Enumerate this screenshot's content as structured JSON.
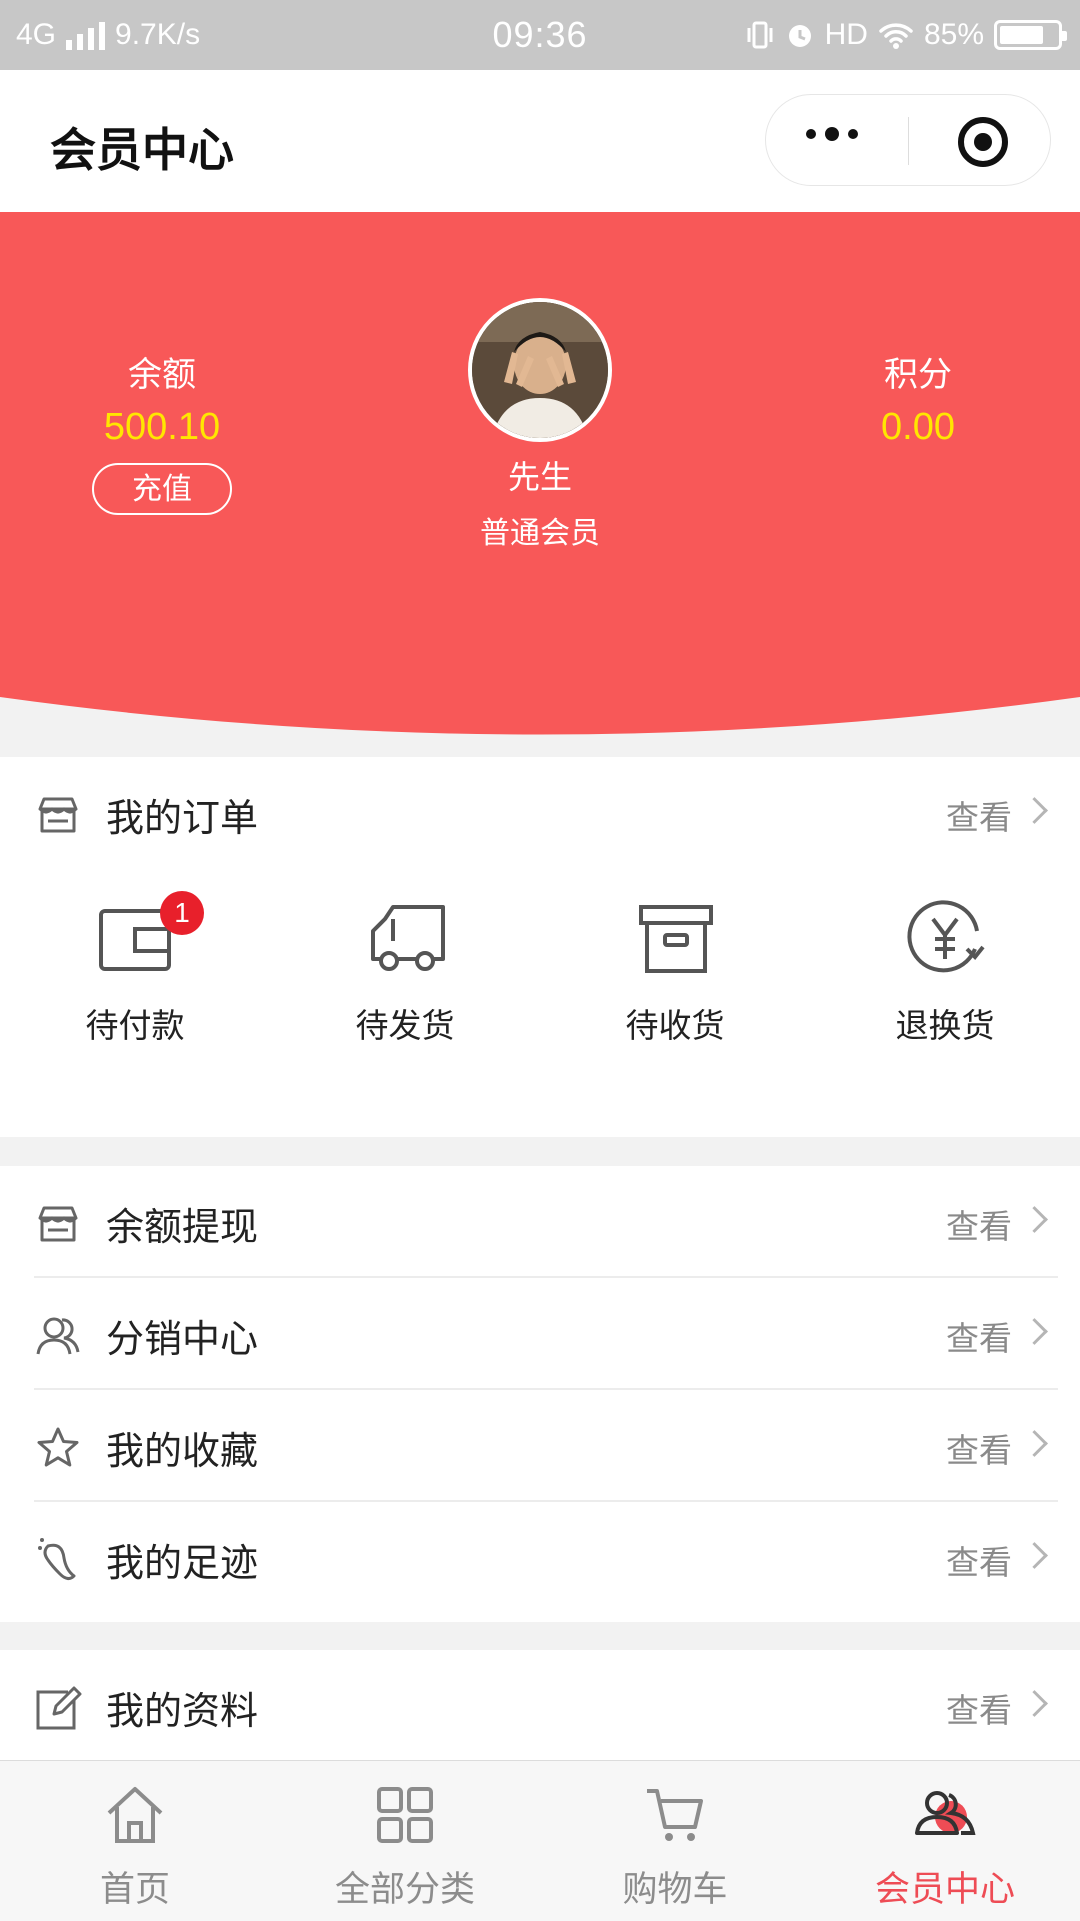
{
  "status_bar": {
    "network": "4G",
    "speed": "9.7K/s",
    "time": "09:36",
    "hd": "HD",
    "battery": "85%"
  },
  "nav": {
    "title": "会员中心",
    "more_icon": "more-dots-icon",
    "close_icon": "target-close-icon"
  },
  "theme": {
    "primary": "#f85858",
    "highlight": "#ffe600",
    "active_tab": "#ee4c55"
  },
  "profile": {
    "balance_label": "余额",
    "balance_value": "500.10",
    "recharge_label": "充值",
    "points_label": "积分",
    "points_value": "0.00",
    "name": "先生",
    "level": "普通会员"
  },
  "orders": {
    "title": "我的订单",
    "more": "查看",
    "items": [
      {
        "label": "待付款",
        "icon": "wallet-icon",
        "badge": "1"
      },
      {
        "label": "待发货",
        "icon": "truck-icon"
      },
      {
        "label": "待收货",
        "icon": "box-icon"
      },
      {
        "label": "退换货",
        "icon": "yen-refund-icon"
      }
    ]
  },
  "menu": [
    {
      "label": "余额提现",
      "more": "查看",
      "icon": "store-icon"
    },
    {
      "label": "分销中心",
      "more": "查看",
      "icon": "users-icon"
    },
    {
      "label": "我的收藏",
      "more": "查看",
      "icon": "star-icon"
    },
    {
      "label": "我的足迹",
      "more": "查看",
      "icon": "footprint-icon"
    }
  ],
  "profile_row": {
    "label": "我的资料",
    "more": "查看",
    "icon": "edit-icon"
  },
  "tabs": [
    {
      "label": "首页",
      "icon": "home-icon"
    },
    {
      "label": "全部分类",
      "icon": "grid-icon"
    },
    {
      "label": "购物车",
      "icon": "cart-icon"
    },
    {
      "label": "会员中心",
      "icon": "member-icon",
      "active": true
    }
  ]
}
